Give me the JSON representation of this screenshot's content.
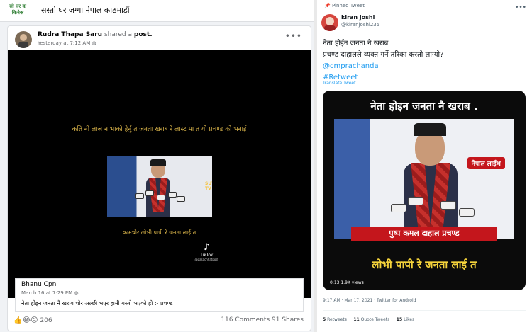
{
  "group": {
    "logo_text": "सो घर क किनेक",
    "title": "सस्तो घर जग्गा नेपाल काठमाडौं"
  },
  "post": {
    "author": "Rudra Thapa Saru",
    "shared_text": "shared a",
    "shared_object": "post.",
    "timestamp": "Yesterday at 7:12 AM",
    "video": {
      "caption_top": "कति नी लाज न भाको हेर्नु त जनता खराब रे लास्ट मा त यो प्रचण्ड को भनाई",
      "caption_bottom": "कामचोर लोभी पापी रे जनता लाई त",
      "tv_logo": "SUTH TV",
      "tiktok_label": "TikTok",
      "tiktok_handle": "@pasachhatpost"
    },
    "shared_post": {
      "author": "Bhanu Cpn",
      "timestamp": "March 16 at 7:29 PM",
      "text": "नेता होइन जनता नै खराब चोर अल्छी भएर हामी यस्तो भएको हो :- प्रचण्ड"
    },
    "reactions": {
      "emojis": "👍😂😡",
      "count": "206"
    },
    "comments": "116 Comments",
    "shares": "91 Shares"
  },
  "tweet": {
    "pinned_label": "Pinned Tweet",
    "name": "kiran joshi",
    "handle": "@kiranjoshi235",
    "line1": "नेता होईन जनता नै खराब",
    "line2": "प्रचण्ड दाहालले व्यक्त गर्ने तरिका कस्तो लाग्यो?",
    "mention": "@cmprachanda",
    "hashtag": "#Retweet",
    "translate": "Translate Tweet",
    "media": {
      "headline_top": "नेता होइन जनता नै खराब .",
      "channel_badge": "नेपाल लाईभ",
      "name_bar": "पुष्प कमल दाहाल प्रचण्ड",
      "headline_bottom": "लोभी पापी रे जनता लाई त",
      "duration": "0:13",
      "views": "1.9K views"
    },
    "date_line": "9:17 AM · Mar 17, 2021 · Twitter for Android",
    "stats": {
      "retweets_num": "5",
      "retweets_label": "Retweets",
      "quotes_num": "11",
      "quotes_label": "Quote Tweets",
      "likes_num": "15",
      "likes_label": "Likes"
    }
  }
}
